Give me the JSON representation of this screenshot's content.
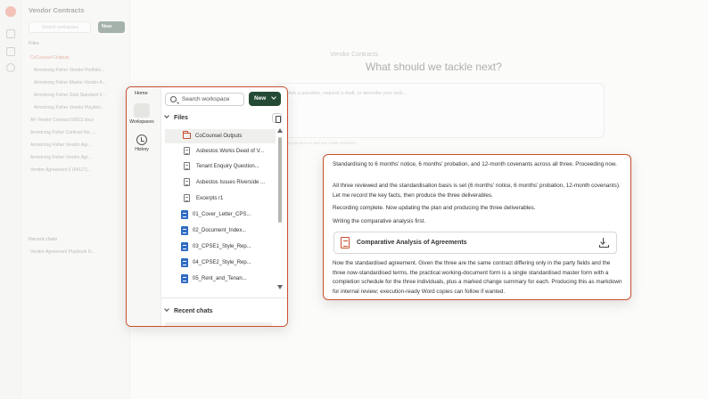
{
  "background": {
    "workspace_title": "Vendor Contracts",
    "search_placeholder": "Search workspace",
    "new_label": "New",
    "files_label": "Files",
    "folder": "CoCounsel Outputs",
    "files": [
      "Armstrong Fisher Vendor Portfolio...",
      "Armstrong Fisher Master Vendor A...",
      "Armstrong Fisher Gold Standard V...",
      "Armstrong Fisher Vendor Playboo...",
      "AF Vendor Contract 58912.docx",
      "Armstrong Fisher Contract No. ...",
      "Armstrong Fisher Vendor Agr...",
      "Armstrong Fisher Vendor Agr...",
      "Vendor Agreement 5 (64117)..."
    ],
    "recent_chats_label": "Recent chats",
    "recent_chat": "Vendor Agreement Playbook D...",
    "main_breadcrumb": "Vendor Contracts",
    "main_heading": "What should we tackle next?",
    "prompt_placeholder": "Ask a question, request a draft, or describe your task...",
    "disclaimer": "CoCounsel is AI and can make mistakes."
  },
  "panel": {
    "nav": {
      "home": "Home",
      "workspaces": "Workspaces",
      "history": "History"
    },
    "search_placeholder": "Search workspace",
    "new_label": "New",
    "files_label": "Files",
    "items": [
      {
        "label": "CoCounsel Outputs",
        "type": "folder"
      },
      {
        "label": "Asbestos Works Deed of V...",
        "type": "doc"
      },
      {
        "label": "Tenant Enquiry Question...",
        "type": "doc"
      },
      {
        "label": "Asbestos Issues Riverside ...",
        "type": "doc"
      },
      {
        "label": "Excerpts r1",
        "type": "doc"
      },
      {
        "label": "01_Cover_Letter_CPS...",
        "type": "word"
      },
      {
        "label": "02_Document_Index...",
        "type": "word"
      },
      {
        "label": "03_CPSE1_Style_Rep...",
        "type": "word"
      },
      {
        "label": "04_CPSE2_Style_Rep...",
        "type": "word"
      },
      {
        "label": "05_Rent_and_Tenan...",
        "type": "word"
      }
    ],
    "recent_chats_label": "Recent chats"
  },
  "chat": {
    "p1": "Standardising to 6 months' notice, 6 months' probation, and 12-month covenants across all three. Proceeding now.",
    "p2": "All three reviewed and the standardisation basis is set (6 months' notice, 6 months' probation, 12-month covenants). Let me record the key facts, then produce the three deliverables.",
    "p3": "Recording complete. Now updating the plan and producing the three deliverables.",
    "p4": "Writing the comparative analysis first.",
    "artifact_title": "Comparative Analysis of Agreements",
    "p5": "Now the standardised agreement. Given the three are the same contract differing only in the party fields and the three now-standardised terms, the practical working-document form is a single standardised master form with a completion schedule for the three individuals, plus a marked change summary for each. Producing this as markdown for internal review; execution-ready Word copies can follow if wanted."
  },
  "colors": {
    "accent": "#c9502f",
    "primary_button": "#244a36",
    "word_icon": "#2f6bc6"
  }
}
